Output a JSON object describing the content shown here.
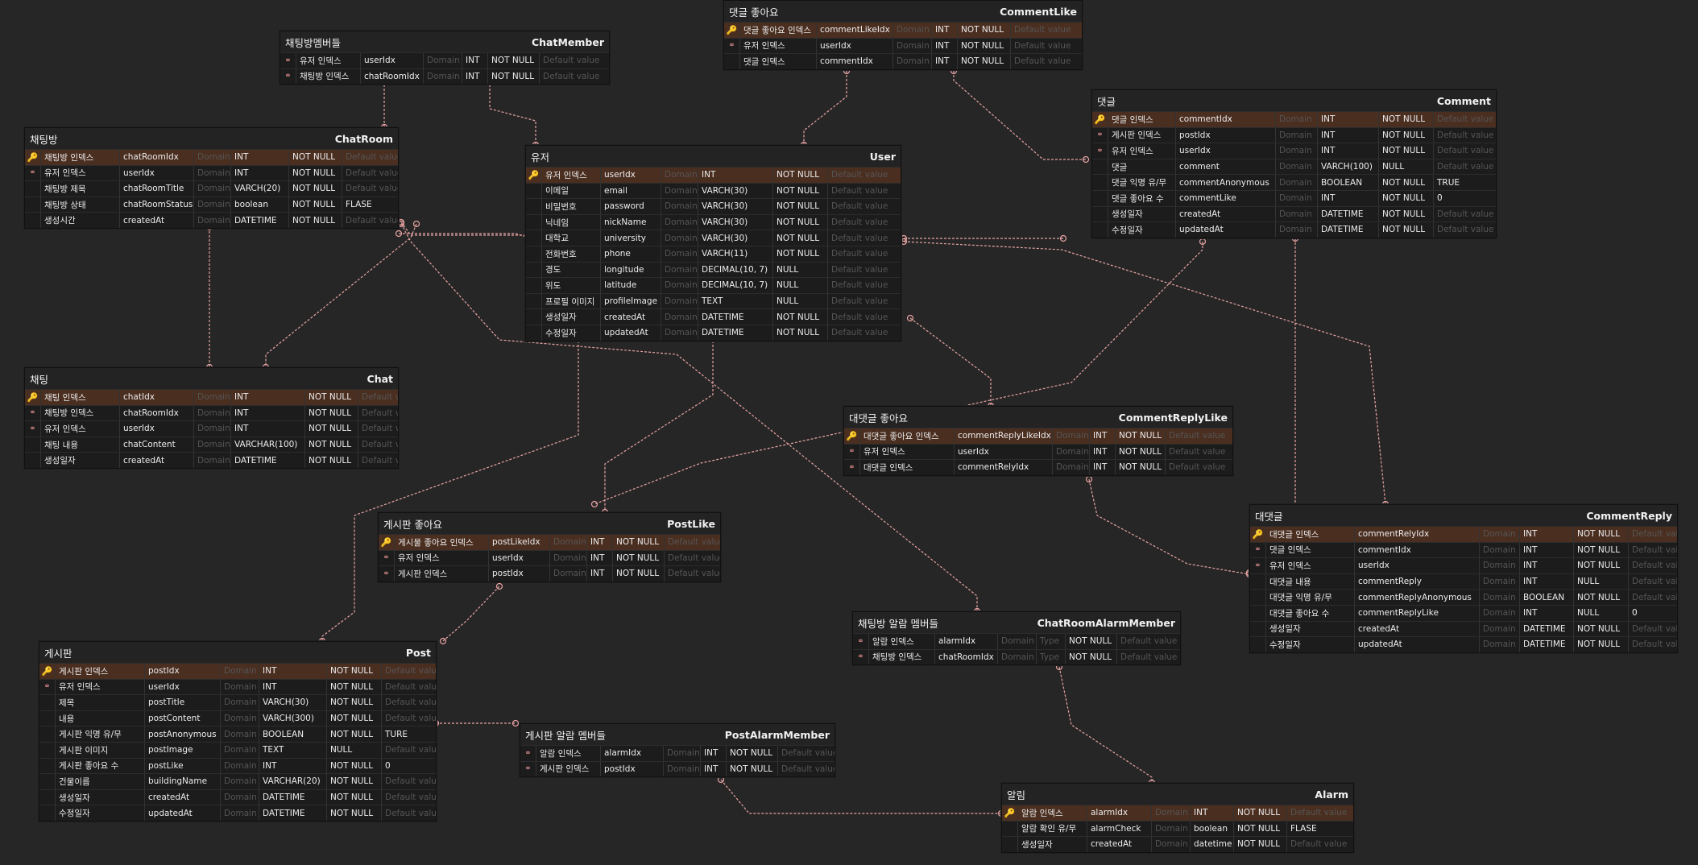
{
  "diagram": {
    "link_color": "#e8a3a3",
    "tables": [
      {
        "id": "ChatMember",
        "title_ko": "채팅방멤버들",
        "title_en": "ChatMember",
        "columns": [
          {
            "ko": "유저 인덱스",
            "name": "userIdx",
            "domain": "Domain",
            "type": "INT",
            "nn": "NOT NULL",
            "def": "Default value",
            "key": "fk"
          },
          {
            "ko": "채팅방 인덱스",
            "name": "chatRoomIdx",
            "domain": "Domain",
            "type": "INT",
            "nn": "NOT NULL",
            "def": "Default value",
            "key": "fk"
          }
        ]
      },
      {
        "id": "CommentLike",
        "title_ko": "댓글 좋아요",
        "title_en": "CommentLike",
        "columns": [
          {
            "ko": "댓글 좋아요 인덱스",
            "name": "commentLikeIdx",
            "domain": "Domain",
            "type": "INT",
            "nn": "NOT NULL",
            "def": "Default value",
            "key": "pk"
          },
          {
            "ko": "유저 인덱스",
            "name": "userIdx",
            "domain": "Domain",
            "type": "INT",
            "nn": "NOT NULL",
            "def": "Default value",
            "key": "fk"
          },
          {
            "ko": "댓글 인덱스",
            "name": "commentIdx",
            "domain": "Domain",
            "type": "INT",
            "nn": "NOT NULL",
            "def": "Default value",
            "key": ""
          }
        ]
      },
      {
        "id": "ChatRoom",
        "title_ko": "채팅방",
        "title_en": "ChatRoom",
        "columns": [
          {
            "ko": "채팅방 인덱스",
            "name": "chatRoomIdx",
            "domain": "Domain",
            "type": "INT",
            "nn": "NOT NULL",
            "def": "Default value",
            "key": "pk"
          },
          {
            "ko": "유저 인덱스",
            "name": "userIdx",
            "domain": "Domain",
            "type": "INT",
            "nn": "NOT NULL",
            "def": "Default value",
            "key": "fk"
          },
          {
            "ko": "채팅방 제목",
            "name": "chatRoomTitle",
            "domain": "Domain",
            "type": "VARCH(20)",
            "nn": "NOT NULL",
            "def": "Default value",
            "key": ""
          },
          {
            "ko": "채팅방 상태",
            "name": "chatRoomStatus",
            "domain": "Domain",
            "type": "boolean",
            "nn": "NOT NULL",
            "def": "FLASE",
            "key": ""
          },
          {
            "ko": "생성시간",
            "name": "createdAt",
            "domain": "Domain",
            "type": "DATETIME",
            "nn": "NOT NULL",
            "def": "Default value",
            "key": ""
          }
        ]
      },
      {
        "id": "User",
        "title_ko": "유저",
        "title_en": "User",
        "columns": [
          {
            "ko": "유저 인덱스",
            "name": "userIdx",
            "domain": "Domain",
            "type": "INT",
            "nn": "NOT NULL",
            "def": "Default value",
            "key": "pk"
          },
          {
            "ko": "이메일",
            "name": "email",
            "domain": "Domain",
            "type": "VARCH(30)",
            "nn": "NOT NULL",
            "def": "Default value",
            "key": ""
          },
          {
            "ko": "비밀번호",
            "name": "password",
            "domain": "Domain",
            "type": "VARCH(30)",
            "nn": "NOT NULL",
            "def": "Default value",
            "key": ""
          },
          {
            "ko": "닉네임",
            "name": "nickName",
            "domain": "Domain",
            "type": "VARCH(30)",
            "nn": "NOT NULL",
            "def": "Default value",
            "key": ""
          },
          {
            "ko": "대학교",
            "name": "university",
            "domain": "Domain",
            "type": "VARCH(30)",
            "nn": "NOT NULL",
            "def": "Default value",
            "key": ""
          },
          {
            "ko": "전화번호",
            "name": "phone",
            "domain": "Domain",
            "type": "VARCH(11)",
            "nn": "NOT NULL",
            "def": "Default value",
            "key": ""
          },
          {
            "ko": "경도",
            "name": "longitude",
            "domain": "Domain",
            "type": "DECIMAL(10, 7)",
            "nn": "NULL",
            "def": "Default value",
            "key": ""
          },
          {
            "ko": "위도",
            "name": "latitude",
            "domain": "Domain",
            "type": "DECIMAL(10, 7)",
            "nn": "NULL",
            "def": "Default value",
            "key": ""
          },
          {
            "ko": "프로필 이미지",
            "name": "profileImage",
            "domain": "Domain",
            "type": "TEXT",
            "nn": "NULL",
            "def": "Default value",
            "key": ""
          },
          {
            "ko": "생성일자",
            "name": "createdAt",
            "domain": "Domain",
            "type": "DATETIME",
            "nn": "NOT NULL",
            "def": "Default value",
            "key": ""
          },
          {
            "ko": "수정일자",
            "name": "updatedAt",
            "domain": "Domain",
            "type": "DATETIME",
            "nn": "NOT NULL",
            "def": "Default value",
            "key": ""
          }
        ]
      },
      {
        "id": "Comment",
        "title_ko": "댓글",
        "title_en": "Comment",
        "columns": [
          {
            "ko": "댓글 인덱스",
            "name": "commentIdx",
            "domain": "Domain",
            "type": "INT",
            "nn": "NOT NULL",
            "def": "Default value",
            "key": "pk"
          },
          {
            "ko": "게시판 인덱스",
            "name": "postIdx",
            "domain": "Domain",
            "type": "INT",
            "nn": "NOT NULL",
            "def": "Default value",
            "key": "fk"
          },
          {
            "ko": "유저 인덱스",
            "name": "userIdx",
            "domain": "Domain",
            "type": "INT",
            "nn": "NOT NULL",
            "def": "Default value",
            "key": "fk"
          },
          {
            "ko": "댓글",
            "name": "comment",
            "domain": "Domain",
            "type": "VARCH(100)",
            "nn": "NULL",
            "def": "Default value",
            "key": ""
          },
          {
            "ko": "댓글 익명 유/무",
            "name": "commentAnonymous",
            "domain": "Domain",
            "type": "BOOLEAN",
            "nn": "NOT NULL",
            "def": "TRUE",
            "key": ""
          },
          {
            "ko": "댓글 좋아요 수",
            "name": "commentLike",
            "domain": "Domain",
            "type": "INT",
            "nn": "NOT NULL",
            "def": "0",
            "key": ""
          },
          {
            "ko": "생성일자",
            "name": "createdAt",
            "domain": "Domain",
            "type": "DATETIME",
            "nn": "NOT NULL",
            "def": "Default value",
            "key": ""
          },
          {
            "ko": "수정일자",
            "name": "updatedAt",
            "domain": "Domain",
            "type": "DATETIME",
            "nn": "NOT NULL",
            "def": "Default value",
            "key": ""
          }
        ]
      },
      {
        "id": "Chat",
        "title_ko": "채팅",
        "title_en": "Chat",
        "columns": [
          {
            "ko": "채팅 인덱스",
            "name": "chatIdx",
            "domain": "Domain",
            "type": "INT",
            "nn": "NOT NULL",
            "def": "Default value",
            "key": "pk"
          },
          {
            "ko": "채팅방 인덱스",
            "name": "chatRoomIdx",
            "domain": "Domain",
            "type": "INT",
            "nn": "NOT NULL",
            "def": "Default value",
            "key": "fk"
          },
          {
            "ko": "유저 인덱스",
            "name": "userIdx",
            "domain": "Domain",
            "type": "INT",
            "nn": "NOT NULL",
            "def": "Default value",
            "key": "fk"
          },
          {
            "ko": "채팅 내용",
            "name": "chatContent",
            "domain": "Domain",
            "type": "VARCHAR(100)",
            "nn": "NOT NULL",
            "def": "Default value",
            "key": ""
          },
          {
            "ko": "생성일자",
            "name": "createdAt",
            "domain": "Domain",
            "type": "DATETIME",
            "nn": "NOT NULL",
            "def": "Default value",
            "key": ""
          }
        ]
      },
      {
        "id": "CommentReplyLike",
        "title_ko": "대댓글 좋아요",
        "title_en": "CommentReplyLike",
        "columns": [
          {
            "ko": "대댓글 좋아요 인덱스",
            "name": "commentReplyLikeIdx",
            "domain": "Domain",
            "type": "INT",
            "nn": "NOT NULL",
            "def": "Default value",
            "key": "pk"
          },
          {
            "ko": "유저 인덱스",
            "name": "userIdx",
            "domain": "Domain",
            "type": "INT",
            "nn": "NOT NULL",
            "def": "Default value",
            "key": "fk"
          },
          {
            "ko": "대댓글 인덱스",
            "name": "commentRelyIdx",
            "domain": "Domain",
            "type": "INT",
            "nn": "NOT NULL",
            "def": "Default value",
            "key": "fk"
          }
        ]
      },
      {
        "id": "CommentReply",
        "title_ko": "대댓글",
        "title_en": "CommentReply",
        "columns": [
          {
            "ko": "대댓글 인덱스",
            "name": "commentRelyIdx",
            "domain": "Domain",
            "type": "INT",
            "nn": "NOT NULL",
            "def": "Default value",
            "key": "pk"
          },
          {
            "ko": "댓글 인덱스",
            "name": "commentIdx",
            "domain": "Domain",
            "type": "INT",
            "nn": "NOT NULL",
            "def": "Default value",
            "key": "fk"
          },
          {
            "ko": "유저 인덱스",
            "name": "userIdx",
            "domain": "Domain",
            "type": "INT",
            "nn": "NOT NULL",
            "def": "Default value",
            "key": "fk"
          },
          {
            "ko": "대댓글 내용",
            "name": "commentReply",
            "domain": "Domain",
            "type": "INT",
            "nn": "NULL",
            "def": "Default value",
            "key": ""
          },
          {
            "ko": "대댓글 익명 유/무",
            "name": "commentReplyAnonymous",
            "domain": "Domain",
            "type": "BOOLEAN",
            "nn": "NOT NULL",
            "def": "Default value",
            "key": ""
          },
          {
            "ko": "대댓글 좋아요 수",
            "name": "commentReplyLike",
            "domain": "Domain",
            "type": "INT",
            "nn": "NULL",
            "def": "0",
            "key": ""
          },
          {
            "ko": "생성일자",
            "name": "createdAt",
            "domain": "Domain",
            "type": "DATETIME",
            "nn": "NOT NULL",
            "def": "Default value",
            "key": ""
          },
          {
            "ko": "수정일자",
            "name": "updatedAt",
            "domain": "Domain",
            "type": "DATETIME",
            "nn": "NOT NULL",
            "def": "Default value",
            "key": ""
          }
        ]
      },
      {
        "id": "PostLike",
        "title_ko": "게시판 좋아요",
        "title_en": "PostLike",
        "columns": [
          {
            "ko": "게시물 좋아요 인덱스",
            "name": "postLikeIdx",
            "domain": "Domain",
            "type": "INT",
            "nn": "NOT NULL",
            "def": "Default value",
            "key": "pk"
          },
          {
            "ko": "유저 인덱스",
            "name": "userIdx",
            "domain": "Domain",
            "type": "INT",
            "nn": "NOT NULL",
            "def": "Default value",
            "key": "fk"
          },
          {
            "ko": "게시판 인덱스",
            "name": "postIdx",
            "domain": "Domain",
            "type": "INT",
            "nn": "NOT NULL",
            "def": "Default value",
            "key": "fk"
          }
        ]
      },
      {
        "id": "ChatRoomAlarmMember",
        "title_ko": "채팅방 알람 멤버들",
        "title_en": "ChatRoomAlarmMember",
        "columns": [
          {
            "ko": "알람 인덱스",
            "name": "alarmIdx",
            "domain": "Domain",
            "type": "Type",
            "nn": "NOT NULL",
            "def": "Default value",
            "key": "fk"
          },
          {
            "ko": "채팅방 인덱스",
            "name": "chatRoomIdx",
            "domain": "Domain",
            "type": "Type",
            "nn": "NOT NULL",
            "def": "Default value",
            "key": "fk"
          }
        ]
      },
      {
        "id": "Post",
        "title_ko": "게시판",
        "title_en": "Post",
        "columns": [
          {
            "ko": "게시판 인덱스",
            "name": "postIdx",
            "domain": "Domain",
            "type": "INT",
            "nn": "NOT NULL",
            "def": "Default value",
            "key": "pk"
          },
          {
            "ko": "유저 인덱스",
            "name": "userIdx",
            "domain": "Domain",
            "type": "INT",
            "nn": "NOT NULL",
            "def": "Default value",
            "key": "fk"
          },
          {
            "ko": "제목",
            "name": "postTitle",
            "domain": "Domain",
            "type": "VARCH(30)",
            "nn": "NOT NULL",
            "def": "Default value",
            "key": ""
          },
          {
            "ko": "내용",
            "name": "postContent",
            "domain": "Domain",
            "type": "VARCH(300)",
            "nn": "NOT NULL",
            "def": "Default value",
            "key": ""
          },
          {
            "ko": "게시판 익명 유/무",
            "name": "postAnonymous",
            "domain": "Domain",
            "type": "BOOLEAN",
            "nn": "NOT NULL",
            "def": "TURE",
            "key": ""
          },
          {
            "ko": "게시판 이미지",
            "name": "postImage",
            "domain": "Domain",
            "type": "TEXT",
            "nn": "NULL",
            "def": "Default value",
            "key": ""
          },
          {
            "ko": "게시판 좋아요 수",
            "name": "postLike",
            "domain": "Domain",
            "type": "INT",
            "nn": "NOT NULL",
            "def": "0",
            "key": ""
          },
          {
            "ko": "건물이름",
            "name": "buildingName",
            "domain": "Domain",
            "type": "VARCHAR(20)",
            "nn": "NOT NULL",
            "def": "Default value",
            "key": ""
          },
          {
            "ko": "생성일자",
            "name": "createdAt",
            "domain": "Domain",
            "type": "DATETIME",
            "nn": "NOT NULL",
            "def": "Default value",
            "key": ""
          },
          {
            "ko": "수정일자",
            "name": "updatedAt",
            "domain": "Domain",
            "type": "DATETIME",
            "nn": "NOT NULL",
            "def": "Default value",
            "key": ""
          }
        ]
      },
      {
        "id": "PostAlarmMember",
        "title_ko": "게시판 알람 멤버들",
        "title_en": "PostAlarmMember",
        "columns": [
          {
            "ko": "알람 인덱스",
            "name": "alarmIdx",
            "domain": "Domain",
            "type": "INT",
            "nn": "NOT NULL",
            "def": "Default value",
            "key": "fk"
          },
          {
            "ko": "게시판 인덱스",
            "name": "postIdx",
            "domain": "Domain",
            "type": "INT",
            "nn": "NOT NULL",
            "def": "Default value",
            "key": "fk"
          }
        ]
      },
      {
        "id": "Alarm",
        "title_ko": "알림",
        "title_en": "Alarm",
        "columns": [
          {
            "ko": "알람 인덱스",
            "name": "alarmIdx",
            "domain": "Domain",
            "type": "INT",
            "nn": "NOT NULL",
            "def": "Default value",
            "key": "pk"
          },
          {
            "ko": "알람 확인 유/무",
            "name": "alarmCheck",
            "domain": "Domain",
            "type": "boolean",
            "nn": "NOT NULL",
            "def": "FLASE",
            "key": ""
          },
          {
            "ko": "생성일자",
            "name": "createdAt",
            "domain": "Domain",
            "type": "datetime",
            "nn": "NOT NULL",
            "def": "Default value",
            "key": ""
          }
        ]
      }
    ]
  }
}
